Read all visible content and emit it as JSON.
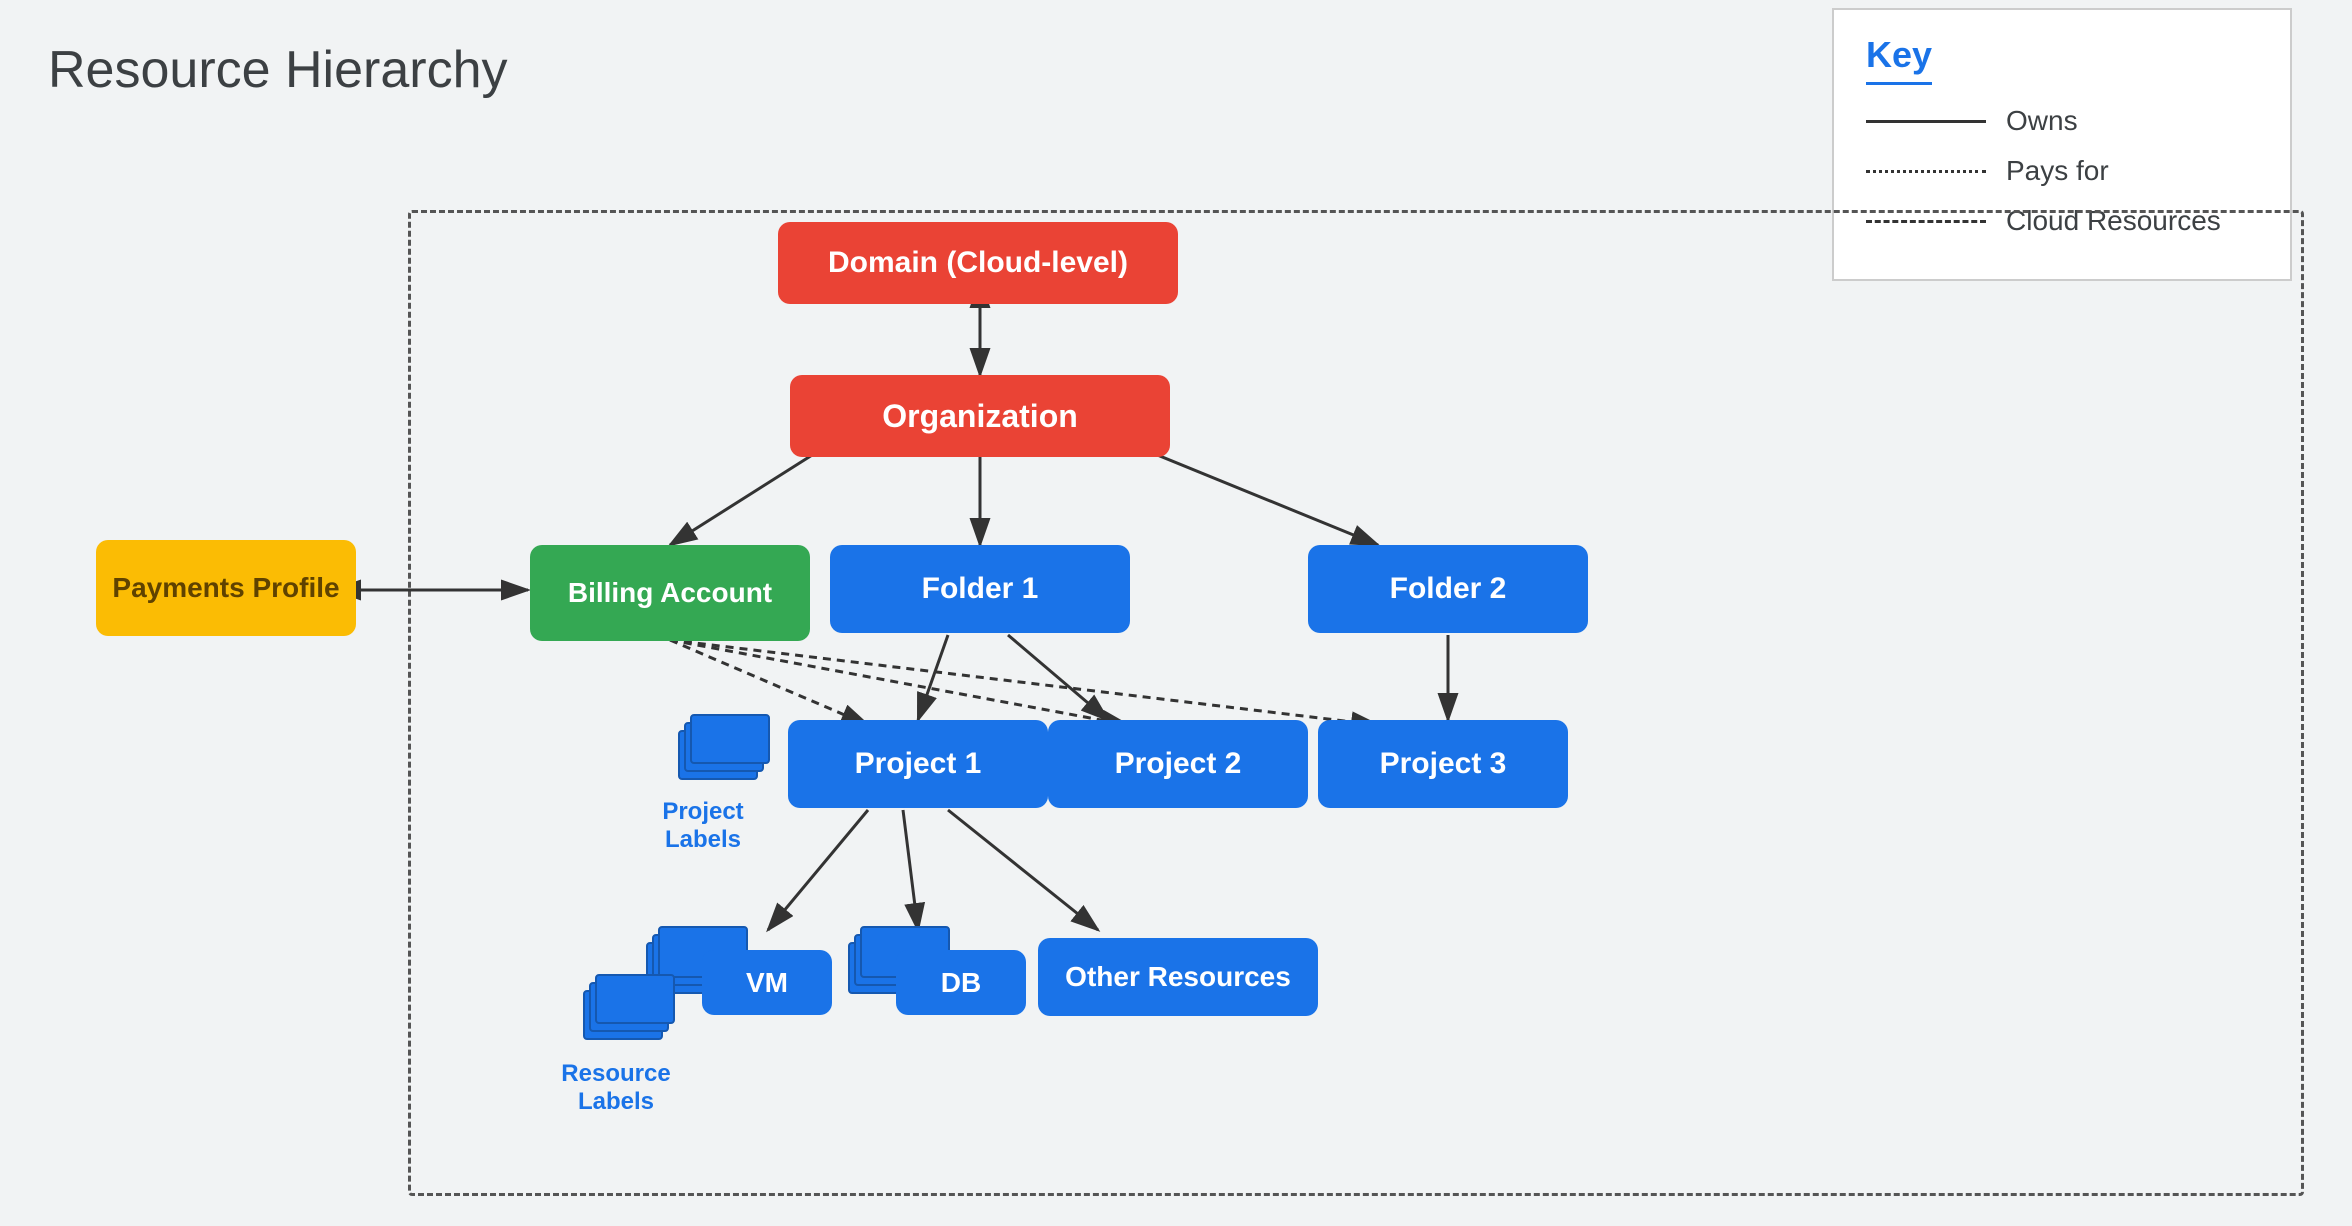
{
  "title": "Resource Hierarchy",
  "key": {
    "title": "Key",
    "items": [
      {
        "label": "Owns",
        "type": "solid"
      },
      {
        "label": "Pays for",
        "type": "dotted"
      },
      {
        "label": "Cloud Resources",
        "type": "dashed"
      }
    ]
  },
  "nodes": {
    "domain": "Domain (Cloud-level)",
    "organization": "Organization",
    "billing_account": "Billing Account",
    "payments_profile": "Payments Profile",
    "folder1": "Folder 1",
    "folder2": "Folder 2",
    "project1": "Project 1",
    "project2": "Project 2",
    "project3": "Project 3",
    "vm": "VM",
    "db": "DB",
    "other_resources": "Other Resources"
  },
  "labels": {
    "project_labels": "Project\nLabels",
    "resource_labels": "Resource\nLabels"
  }
}
